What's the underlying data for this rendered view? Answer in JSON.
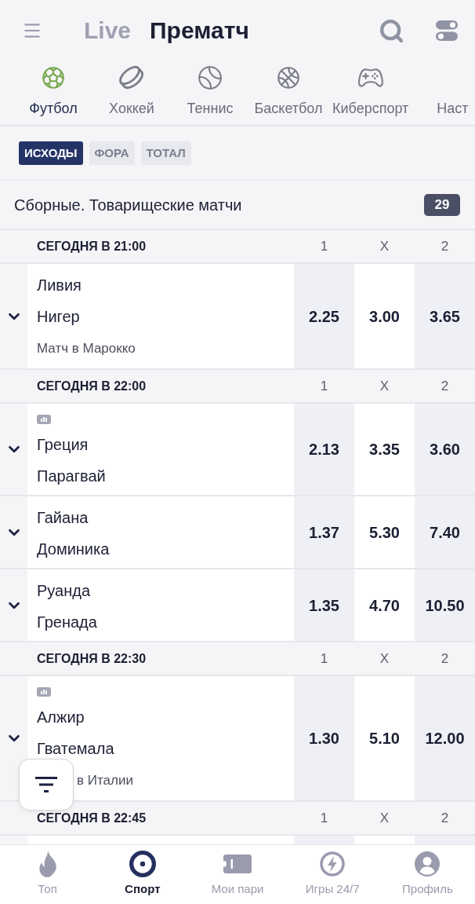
{
  "header": {
    "tabs": [
      {
        "label": "Live",
        "selected": false
      },
      {
        "label": "Прематч",
        "selected": true
      }
    ]
  },
  "sports": [
    {
      "kind": "football",
      "label": "Футбол",
      "selected": true
    },
    {
      "kind": "hockey",
      "label": "Хоккей",
      "selected": false
    },
    {
      "kind": "tennis",
      "label": "Теннис",
      "selected": false
    },
    {
      "kind": "basketball",
      "label": "Баскетбол",
      "selected": false
    },
    {
      "kind": "esports",
      "label": "Киберспорт",
      "selected": false
    },
    {
      "label": "Наст",
      "selected": false
    }
  ],
  "markets": [
    {
      "label": "ИСХОДЫ",
      "selected": true
    },
    {
      "label": "ФОРА",
      "selected": false
    },
    {
      "label": "ТОТАЛ",
      "selected": false
    }
  ],
  "league": {
    "title": "Сборные. Товарищеские матчи",
    "count": "29"
  },
  "groups": [
    {
      "time": "СЕГОДНЯ В 21:00",
      "columns": [
        "1",
        "X",
        "2"
      ],
      "matches": [
        {
          "stats_badge": false,
          "teams": [
            "Ливия",
            "Нигер"
          ],
          "venue": "Матч в Марокко",
          "odds": [
            "2.25",
            "3.00",
            "3.65"
          ]
        }
      ]
    },
    {
      "time": "СЕГОДНЯ В 22:00",
      "columns": [
        "1",
        "X",
        "2"
      ],
      "matches": [
        {
          "stats_badge": true,
          "teams": [
            "Греция",
            "Парагвай"
          ],
          "odds": [
            "2.13",
            "3.35",
            "3.60"
          ]
        },
        {
          "stats_badge": false,
          "teams": [
            "Гайана",
            "Доминика"
          ],
          "odds": [
            "1.37",
            "5.30",
            "7.40"
          ]
        },
        {
          "stats_badge": false,
          "teams": [
            "Руанда",
            "Гренада"
          ],
          "odds": [
            "1.35",
            "4.70",
            "10.50"
          ]
        }
      ]
    },
    {
      "time": "СЕГОДНЯ В 22:30",
      "columns": [
        "1",
        "X",
        "2"
      ],
      "matches": [
        {
          "stats_badge": true,
          "teams": [
            "Алжир",
            "Гватемала"
          ],
          "venue": "в Италии",
          "odds": [
            "1.30",
            "5.10",
            "12.00"
          ]
        }
      ]
    },
    {
      "time": "СЕГОДНЯ В 22:45",
      "columns": [
        "1",
        "X",
        "2"
      ]
    }
  ],
  "bottom_nav": [
    {
      "kind": "flame",
      "label": "Топ",
      "selected": false
    },
    {
      "kind": "target",
      "label": "Спорт",
      "selected": true
    },
    {
      "kind": "ticket",
      "label": "Мои пари",
      "selected": false
    },
    {
      "kind": "bolt",
      "label": "Игры 24/7",
      "selected": false
    },
    {
      "kind": "user",
      "label": "Профиль",
      "selected": false
    }
  ]
}
